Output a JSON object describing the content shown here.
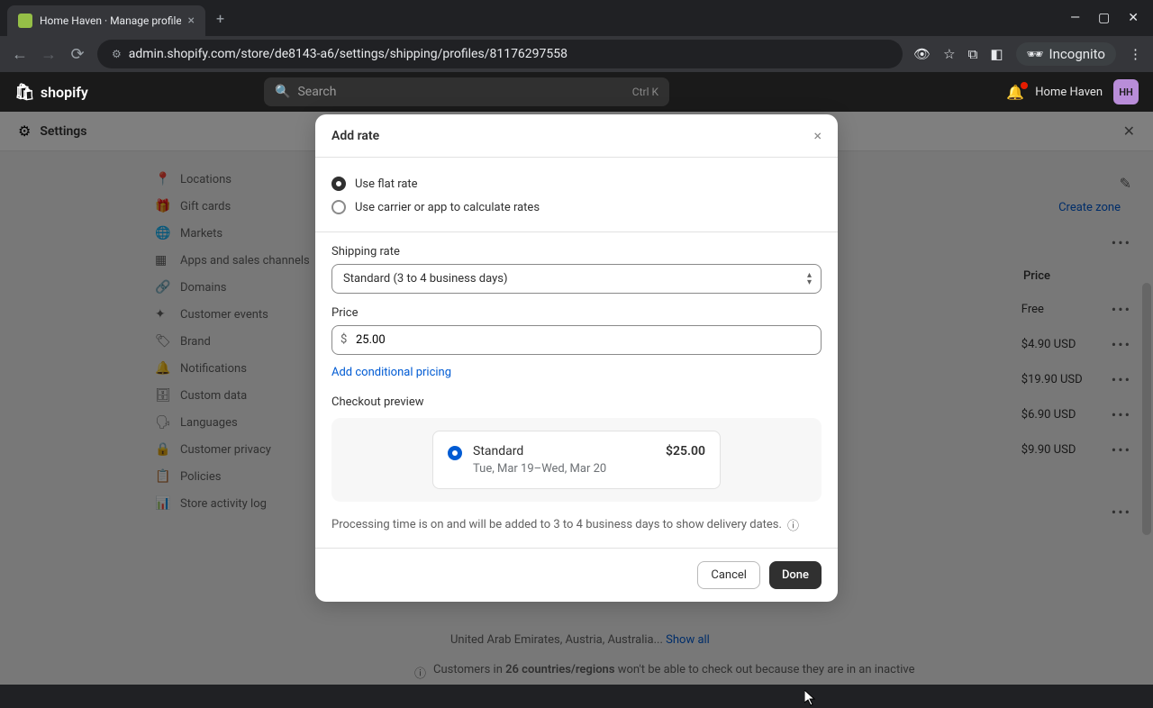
{
  "browser": {
    "tab_title": "Home Haven · Manage profile",
    "url": "admin.shopify.com/store/de8143-a6/settings/shipping/profiles/81176297558",
    "incognito": "Incognito"
  },
  "header": {
    "logo": "shopify",
    "search_placeholder": "Search",
    "search_kbd": "Ctrl K",
    "store_name": "Home Haven",
    "avatar": "HH"
  },
  "settings": {
    "title": "Settings"
  },
  "sidebar": {
    "items": [
      {
        "icon": "📍",
        "label": "Locations"
      },
      {
        "icon": "🎁",
        "label": "Gift cards"
      },
      {
        "icon": "🌐",
        "label": "Markets"
      },
      {
        "icon": "▦",
        "label": "Apps and sales channels"
      },
      {
        "icon": "🔗",
        "label": "Domains"
      },
      {
        "icon": "✦",
        "label": "Customer events"
      },
      {
        "icon": "🏷",
        "label": "Brand"
      },
      {
        "icon": "🔔",
        "label": "Notifications"
      },
      {
        "icon": "🗄",
        "label": "Custom data"
      },
      {
        "icon": "🗣",
        "label": "Languages"
      },
      {
        "icon": "🔒",
        "label": "Customer privacy"
      },
      {
        "icon": "📋",
        "label": "Policies"
      },
      {
        "icon": "📊",
        "label": "Store activity log"
      }
    ]
  },
  "right_panel": {
    "create_zone": "Create zone",
    "price_header": "Price",
    "rows": [
      {
        "price": "Free"
      },
      {
        "price": "$4.90 USD"
      },
      {
        "price": "$19.90 USD"
      },
      {
        "price": "$6.90 USD"
      },
      {
        "price": "$9.90 USD"
      }
    ]
  },
  "countries_line": {
    "text": "United Arab Emirates, Austria, Australia...",
    "show_all": "Show all"
  },
  "info_bar": {
    "prefix": "Customers in ",
    "bold": "26 countries/regions",
    "suffix": " won't be able to check out because they are in an inactive"
  },
  "modal": {
    "title": "Add rate",
    "radio1": "Use flat rate",
    "radio2": "Use carrier or app to calculate rates",
    "shipping_rate_label": "Shipping rate",
    "shipping_rate_value": "Standard (3 to 4 business days)",
    "price_label": "Price",
    "price_value": "25.00",
    "currency": "$",
    "conditional_link": "Add conditional pricing",
    "preview_label": "Checkout preview",
    "preview_name": "Standard",
    "preview_date": "Tue, Mar 19–Wed, Mar 20",
    "preview_price": "$25.00",
    "processing_note": "Processing time is on and will be added to 3 to 4 business days to show delivery dates.",
    "cancel": "Cancel",
    "done": "Done"
  }
}
